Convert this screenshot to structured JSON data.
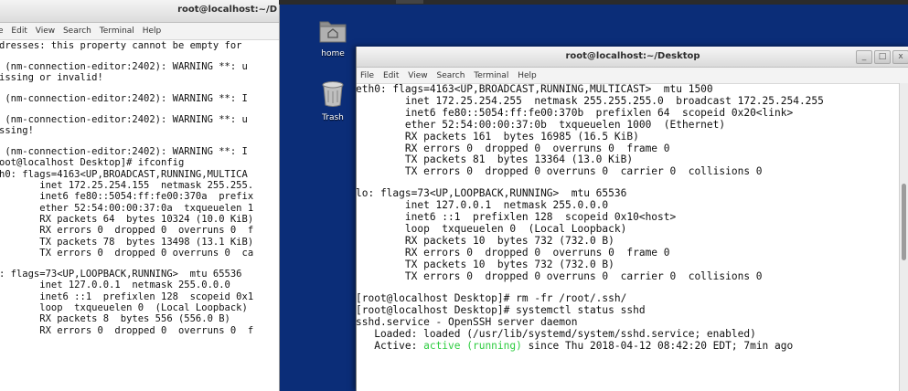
{
  "left_terminal": {
    "title": "root@localhost:~/D",
    "menu": [
      "e",
      "Edit",
      "View",
      "Search",
      "Terminal",
      "Help"
    ],
    "lines": [
      "dresses: this property cannot be empty for",
      "",
      " (nm-connection-editor:2402): WARNING **: u",
      "issing or invalid!",
      "",
      " (nm-connection-editor:2402): WARNING **: I",
      "",
      " (nm-connection-editor:2402): WARNING **: u",
      "ssing!",
      "",
      " (nm-connection-editor:2402): WARNING **: I",
      "oot@localhost Desktop]# ifconfig",
      "h0: flags=4163<UP,BROADCAST,RUNNING,MULTICA",
      "       inet 172.25.254.155  netmask 255.255.",
      "       inet6 fe80::5054:ff:fe00:370a  prefix",
      "       ether 52:54:00:00:37:0a  txqueuelen 1",
      "       RX packets 64  bytes 10324 (10.0 KiB)",
      "       RX errors 0  dropped 0  overruns 0  f",
      "       TX packets 78  bytes 13498 (13.1 KiB)",
      "       TX errors 0  dropped 0 overruns 0  ca",
      "",
      ": flags=73<UP,LOOPBACK,RUNNING>  mtu 65536",
      "       inet 127.0.0.1  netmask 255.0.0.0",
      "       inet6 ::1  prefixlen 128  scopeid 0x1",
      "       loop  txqueuelen 0  (Local Loopback)",
      "       RX packets 8  bytes 556 (556.0 B)",
      "       RX errors 0  dropped 0  overruns 0  f"
    ]
  },
  "desktop": {
    "icons": [
      {
        "label": "home",
        "icon": "folder-home-icon"
      },
      {
        "label": "Trash",
        "icon": "trash-icon"
      }
    ]
  },
  "right_terminal": {
    "title": "root@localhost:~/Desktop",
    "window_buttons": [
      "_",
      "□",
      "x"
    ],
    "menu": [
      "File",
      "Edit",
      "View",
      "Search",
      "Terminal",
      "Help"
    ],
    "lines": [
      "eth0: flags=4163<UP,BROADCAST,RUNNING,MULTICAST>  mtu 1500",
      "        inet 172.25.254.255  netmask 255.255.255.0  broadcast 172.25.254.255",
      "        inet6 fe80::5054:ff:fe00:370b  prefixlen 64  scopeid 0x20<link>",
      "        ether 52:54:00:00:37:0b  txqueuelen 1000  (Ethernet)",
      "        RX packets 161  bytes 16985 (16.5 KiB)",
      "        RX errors 0  dropped 0  overruns 0  frame 0",
      "        TX packets 81  bytes 13364 (13.0 KiB)",
      "        TX errors 0  dropped 0 overruns 0  carrier 0  collisions 0",
      "",
      "lo: flags=73<UP,LOOPBACK,RUNNING>  mtu 65536",
      "        inet 127.0.0.1  netmask 255.0.0.0",
      "        inet6 ::1  prefixlen 128  scopeid 0x10<host>",
      "        loop  txqueuelen 0  (Local Loopback)",
      "        RX packets 10  bytes 732 (732.0 B)",
      "        RX errors 0  dropped 0  overruns 0  frame 0",
      "        TX packets 10  bytes 732 (732.0 B)",
      "        TX errors 0  dropped 0 overruns 0  carrier 0  collisions 0",
      "",
      "[root@localhost Desktop]# rm -fr /root/.ssh/",
      "[root@localhost Desktop]# systemctl status sshd",
      "sshd.service - OpenSSH server daemon",
      "   Loaded: loaded (/usr/lib/systemd/system/sshd.service; enabled)"
    ],
    "active_line": {
      "prefix": "   Active: ",
      "status": "active (running)",
      "suffix": " since Thu 2018-04-12 08:42:20 EDT; 7min ago"
    },
    "colors": {
      "active_status": "#2ecc40"
    }
  }
}
